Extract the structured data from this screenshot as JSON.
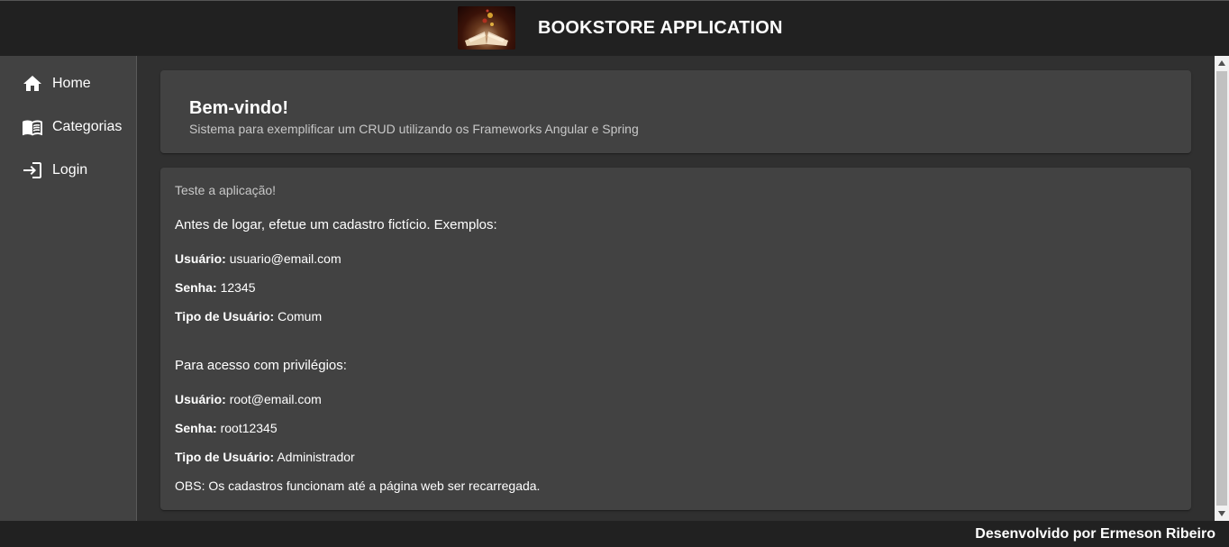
{
  "header": {
    "title": "BOOKSTORE APPLICATION",
    "logo_icon": "open-book-logo"
  },
  "sidebar": {
    "items": [
      {
        "label": "Home",
        "icon": "home-icon"
      },
      {
        "label": "Categorias",
        "icon": "book-icon"
      },
      {
        "label": "Login",
        "icon": "login-icon"
      }
    ]
  },
  "welcome": {
    "title": "Bem-vindo!",
    "subtitle": "Sistema para exemplificar um CRUD utilizando os Frameworks Angular e Spring"
  },
  "info": {
    "heading": "Teste a aplicação!",
    "intro": "Antes de logar, efetue um cadastro fictício. Exemplos:",
    "user_label": "Usuário:",
    "password_label": "Senha:",
    "type_label": "Tipo de Usuário:",
    "common": {
      "user": "usuario@email.com",
      "password": "12345",
      "type": "Comum"
    },
    "privileged_intro": "Para acesso com privilégios:",
    "admin": {
      "user": "root@email.com",
      "password": "root12345",
      "type": "Administrador"
    },
    "note": "OBS: Os cadastros funcionam até a página web ser recarregada."
  },
  "footer": {
    "credit": "Desenvolvido por Ermeson Ribeiro"
  },
  "colors": {
    "toolbar": "#212121",
    "sidebar": "#424242",
    "background": "#303030",
    "card": "#424242"
  }
}
